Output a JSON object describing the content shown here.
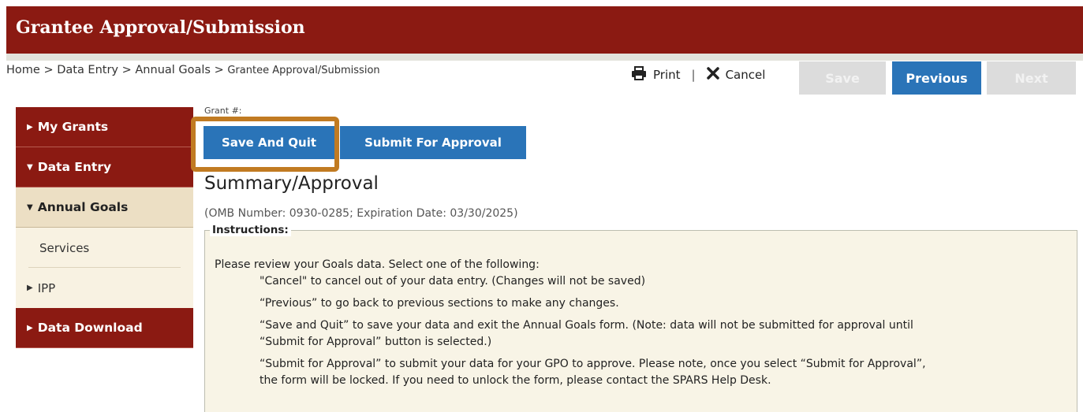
{
  "header": {
    "title": "Grantee Approval/Submission"
  },
  "breadcrumb": {
    "home": "Home",
    "sep": ">",
    "data_entry": "Data Entry",
    "annual_goals": "Annual Goals",
    "current": "Grantee Approval/Submission"
  },
  "actions": {
    "print": "Print",
    "divider": "|",
    "cancel": "Cancel"
  },
  "nav_buttons": {
    "save": "Save",
    "previous": "Previous",
    "next": "Next"
  },
  "sidebar": {
    "items": [
      {
        "label": "My Grants"
      },
      {
        "label": "Data Entry"
      },
      {
        "label": "Annual Goals"
      },
      {
        "label": "Services"
      },
      {
        "label": "IPP"
      },
      {
        "label": "Data Download"
      }
    ]
  },
  "form": {
    "grant_label": "Grant #:",
    "save_and_quit": "Save And Quit",
    "submit_for_approval": "Submit For Approval",
    "summary_title": "Summary/Approval",
    "omb": "(OMB Number: 0930-0285;  Expiration Date: 03/30/2025)"
  },
  "instructions": {
    "legend": "Instructions:",
    "intro": "Please review your Goals data. Select one of the following:",
    "cancel_line": "\"Cancel\" to cancel out of your data entry. (Changes will not be saved)",
    "previous_line": "“Previous” to go back to previous sections to make any changes.",
    "save_quit_line1": "“Save and Quit” to save your data and exit the Annual Goals form. (Note: data will not be submitted for approval until",
    "save_quit_line2": "“Submit for Approval” button is selected.)",
    "submit_line1": "“Submit for Approval” to submit your data for your GPO to approve. Please note, once you select “Submit for Approval”,",
    "submit_line2": "the form will be locked. If you need to unlock the form, please contact the SPARS Help Desk."
  },
  "colors": {
    "brand": "#8b1a12",
    "primary": "#2a74b8",
    "highlight": "#c17b22",
    "active_bg": "#ecdfc4"
  },
  "icons": {
    "print": "printer-icon",
    "cancel": "x-icon",
    "caret_right": "caret-right-icon",
    "caret_down": "caret-down-icon"
  }
}
